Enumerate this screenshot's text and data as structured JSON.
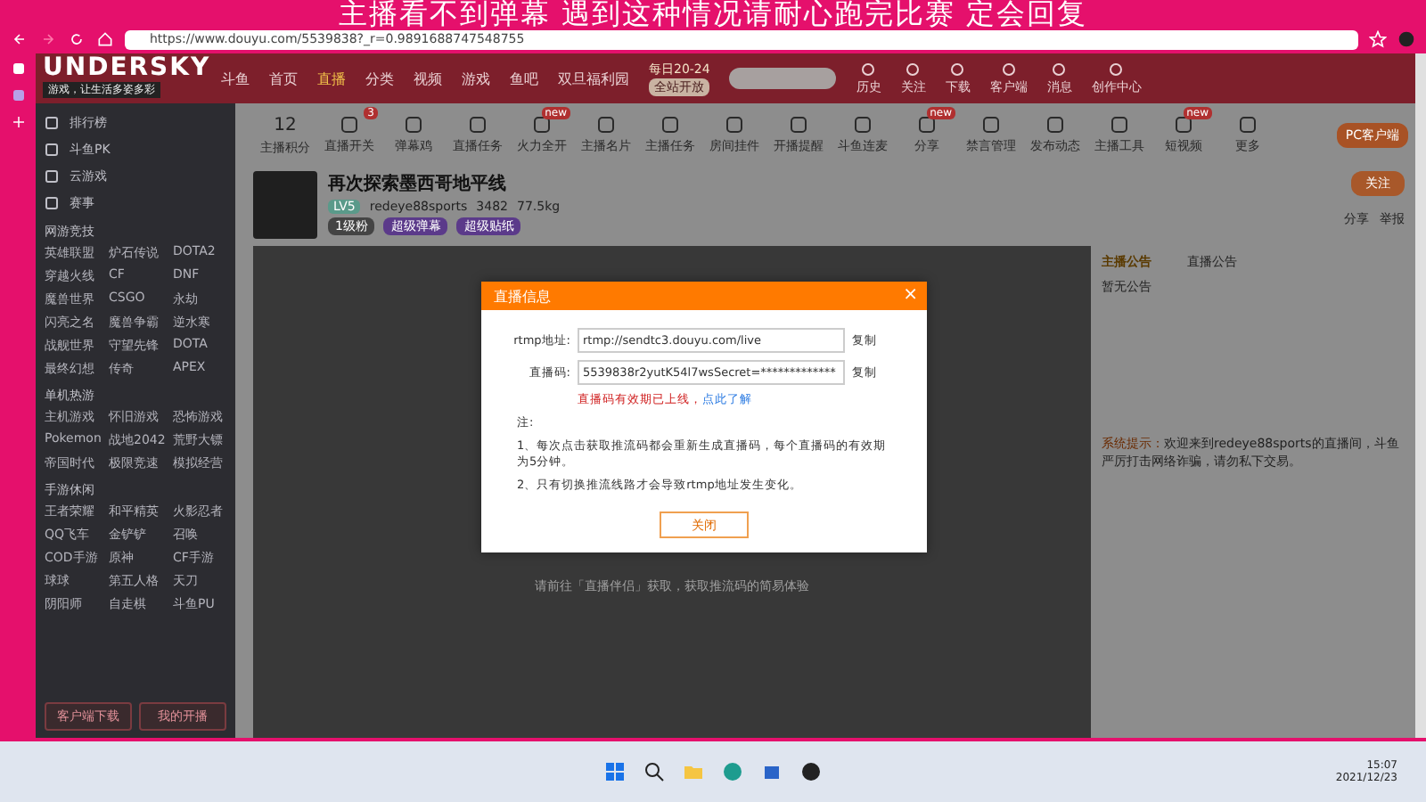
{
  "stream_caption": "主播看不到弹幕 遇到这种情况请耐心跑完比赛 定会回复",
  "browser": {
    "url": "https://www.douyu.com/5539838?_r=0.9891688747548755"
  },
  "overlay_logo": {
    "title": "UNDERSKY",
    "tagline": "游戏，让生活多姿多彩"
  },
  "site_nav": {
    "logo": "斗鱼",
    "items": [
      {
        "label": "首页",
        "selected": false
      },
      {
        "label": "直播",
        "selected": true
      },
      {
        "label": "分类",
        "selected": false
      },
      {
        "label": "视频",
        "selected": false
      },
      {
        "label": "游戏",
        "selected": false
      },
      {
        "label": "鱼吧",
        "selected": false
      },
      {
        "label": "双旦福利园",
        "selected": false
      }
    ],
    "event": {
      "date": "每日20-24",
      "tag": "全站开放"
    },
    "tools": [
      "历史",
      "关注",
      "下载",
      "客户端",
      "消息",
      "创作中心"
    ]
  },
  "sidebar": {
    "links": [
      "排行榜",
      "斗鱼PK",
      "云游戏",
      "赛事"
    ],
    "sections": [
      {
        "title": "网游竞技",
        "items": [
          "英雄联盟",
          "炉石传说",
          "DOTA2",
          "穿越火线",
          "CF",
          "DNF",
          "魔兽世界",
          "CSGO",
          "永劫",
          "闪亮之名",
          "魔兽争霸",
          "逆水寒",
          "战舰世界",
          "守望先锋",
          "DOTA",
          "最终幻想",
          "传奇",
          "APEX"
        ]
      },
      {
        "title": "单机热游",
        "items": [
          "主机游戏",
          "怀旧游戏",
          "恐怖游戏",
          "Pokemon",
          "战地2042",
          "荒野大镖",
          "帝国时代",
          "极限竞速",
          "模拟经营"
        ]
      },
      {
        "title": "手游休闲",
        "items": [
          "王者荣耀",
          "和平精英",
          "火影忍者",
          "QQ飞车",
          "金铲铲",
          "召唤",
          "COD手游",
          "原神",
          "CF手游",
          "球球",
          "第五人格",
          "天刀",
          "阴阳师",
          "自走棋",
          "斗鱼PU"
        ]
      }
    ],
    "buttons": [
      "客户端下载",
      "我的开播"
    ]
  },
  "toolbar": {
    "score": "12",
    "score_label": "主播积分",
    "items": [
      {
        "label": "直播开关",
        "badge": "3"
      },
      {
        "label": "弹幕鸡"
      },
      {
        "label": "直播任务"
      },
      {
        "label": "火力全开",
        "badge": "new"
      },
      {
        "label": "主播名片"
      },
      {
        "label": "主播任务"
      },
      {
        "label": "房间挂件"
      },
      {
        "label": "开播提醒"
      },
      {
        "label": "斗鱼连麦"
      },
      {
        "label": "分享",
        "badge": "new"
      },
      {
        "label": "禁言管理"
      },
      {
        "label": "发布动态"
      },
      {
        "label": "主播工具"
      },
      {
        "label": "短视频",
        "badge": "new"
      },
      {
        "label": "更多"
      }
    ],
    "pc_button": "PC客户端"
  },
  "room": {
    "title": "再次探索墨西哥地平线",
    "streamer": "redeye88sports",
    "level": "LV5",
    "heat": "3482",
    "weight": "77.5kg",
    "follow": "关注",
    "share": "分享",
    "report": "举报",
    "tags": [
      "1级粉",
      "超级弹幕",
      "超级贴纸"
    ]
  },
  "video": {
    "hint": "请前往「直播伴侣」获取，获取推流码的简易体验"
  },
  "dialog": {
    "title": "直播信息",
    "close_icon": "×",
    "fields": [
      {
        "label": "rtmp地址:",
        "value": "rtmp://sendtc3.douyu.com/live",
        "action": "复制"
      },
      {
        "label": "直播码:",
        "value": "5539838r2yutK54l7wsSecret=*************",
        "action": "复制"
      }
    ],
    "warning": "直播码有效期已上线，",
    "link": "点此了解",
    "note_title": "注:",
    "notes": [
      "1、每次点击获取推流码都会重新生成直播码，每个直播码的有效期为5分钟。",
      "2、只有切换推流线路才会导致rtmp地址发生变化。"
    ],
    "close": "关闭"
  },
  "right_panel": {
    "tabs": [
      {
        "label": "主播公告",
        "selected": true
      },
      {
        "label": "直播公告",
        "selected": false
      }
    ],
    "notice": "暂无公告",
    "system_label": "系统提示：",
    "system_text": "欢迎来到redeye88sports的直播间，斗鱼严厉打击网络诈骗，请勿私下交易。"
  },
  "taskbar": {
    "time": "15:07",
    "date": "2021/12/23"
  }
}
